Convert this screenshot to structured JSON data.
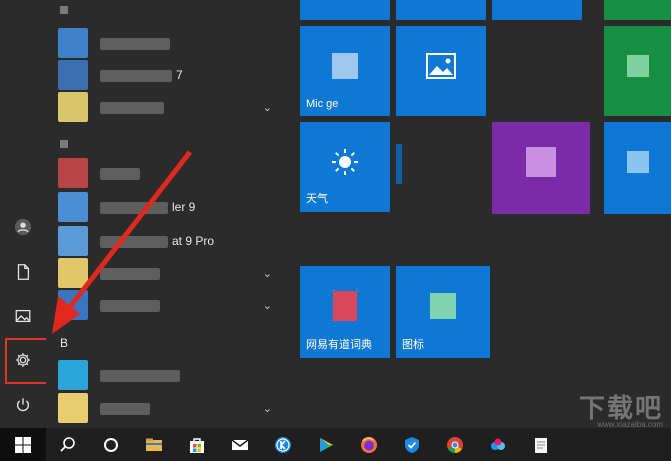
{
  "rail": {
    "items": [
      {
        "name": "user-avatar",
        "icon": "user-icon"
      },
      {
        "name": "documents",
        "icon": "document-icon"
      },
      {
        "name": "pictures",
        "icon": "image-icon"
      },
      {
        "name": "settings",
        "icon": "gear-icon"
      },
      {
        "name": "power",
        "icon": "power-icon"
      }
    ]
  },
  "applist": {
    "group_top": "",
    "rows": [
      {
        "label": "",
        "suffix": "",
        "color": "#3d82c8",
        "chevron": false
      },
      {
        "label": "",
        "suffix": "7",
        "color": "#3b6fb0",
        "chevron": false
      },
      {
        "label": "",
        "suffix": "",
        "color": "#d8c66a",
        "chevron": true
      },
      {
        "label": "",
        "suffix": "",
        "color": "#b84448",
        "chevron": false
      },
      {
        "label": "",
        "suffix": "ler 9",
        "color": "#4a8fd4",
        "chevron": false
      },
      {
        "label": "",
        "suffix": "at 9 Pro",
        "color": "#5b9ad8",
        "chevron": false
      },
      {
        "label": "",
        "suffix": "",
        "color": "#e0c86a",
        "chevron": true
      },
      {
        "label": "",
        "suffix": "",
        "color": "#3a76c0",
        "chevron": true
      }
    ],
    "section_b": "B",
    "rows_b": [
      {
        "label": "",
        "suffix": "",
        "color": "#2aa7d8",
        "chevron": false
      },
      {
        "label": "",
        "suffix": "",
        "color": "#e8cc70",
        "chevron": true
      }
    ]
  },
  "tiles": {
    "edge_label": "Mic          ge",
    "weather_label": "天气",
    "youdao_label": "网易有道词典",
    "other_label": "图标",
    "colors": {
      "blue": "#0f78d4",
      "purple": "#7b2aa8",
      "green": "#168f45"
    }
  },
  "taskbar": {
    "items": [
      "windows-start-icon",
      "search-icon",
      "cortana-icon",
      "file-explorer-icon",
      "store-icon",
      "mail-icon",
      "kugou-icon",
      "play-icon",
      "firefox-icon",
      "shield-icon",
      "chrome-icon",
      "baidu-netdisk-icon",
      "notepad-icon"
    ]
  },
  "watermark": {
    "text": "下载吧",
    "sub": "www.xiazaiba.com"
  }
}
